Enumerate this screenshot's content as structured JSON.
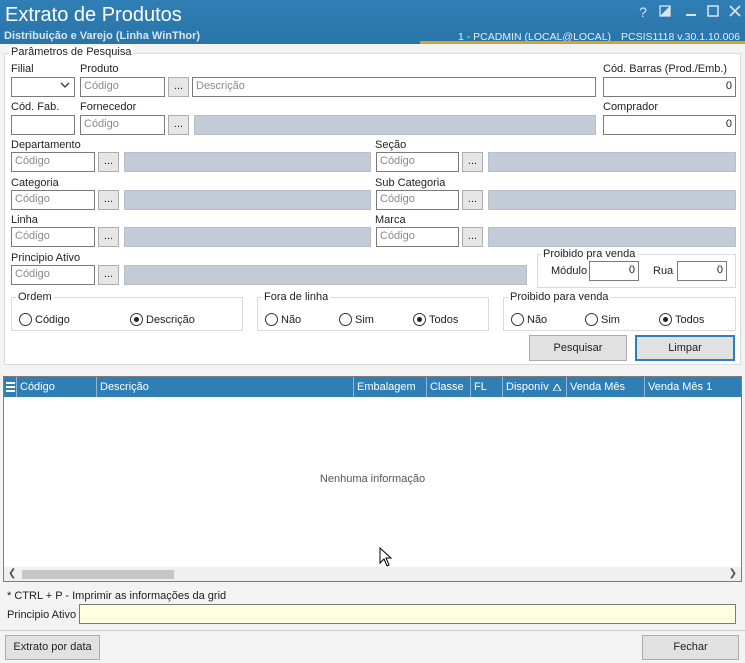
{
  "window": {
    "title": "Extrato de Produtos",
    "subtitle": "Distribuição e Varejo (Linha WinThor)",
    "help_glyph": "?",
    "userinfo": "1 - PCADMIN (LOCAL@LOCAL)",
    "version": "PCSIS1118  v.30.1.10.006"
  },
  "params": {
    "legend": "Parâmetros de Pesquisa",
    "filial": {
      "label": "Filial",
      "value": ""
    },
    "produto": {
      "label": "Produto",
      "code_placeholder": "Código",
      "desc_placeholder": "Descrição"
    },
    "cod_barras": {
      "label": "Cód. Barras (Prod./Emb.)",
      "value": "0"
    },
    "cod_fab": {
      "label": "Cód. Fab.",
      "value": ""
    },
    "fornecedor": {
      "label": "Fornecedor",
      "code_placeholder": "Código"
    },
    "comprador": {
      "label": "Comprador",
      "value": "0"
    },
    "departamento": {
      "label": "Departamento",
      "code_placeholder": "Código"
    },
    "secao": {
      "label": "Seção",
      "code_placeholder": "Código"
    },
    "categoria": {
      "label": "Categoria",
      "code_placeholder": "Código"
    },
    "sub_categoria": {
      "label": "Sub Categoria",
      "code_placeholder": "Código"
    },
    "linha": {
      "label": "Linha",
      "code_placeholder": "Código"
    },
    "marca": {
      "label": "Marca",
      "code_placeholder": "Código"
    },
    "principio_ativo": {
      "label": "Principio Ativo",
      "code_placeholder": "Código"
    },
    "proibido_venda_box": {
      "legend": "Proibido pra venda",
      "modulo_label": "Módulo",
      "modulo_value": "0",
      "rua_label": "Rua",
      "rua_value": "0"
    },
    "dots_label": "..."
  },
  "ordem": {
    "legend": "Ordem",
    "options": [
      {
        "label": "Código",
        "selected": false
      },
      {
        "label": "Descrição",
        "selected": true
      }
    ]
  },
  "fora_de_linha": {
    "legend": "Fora de linha",
    "options": [
      {
        "label": "Não",
        "selected": false
      },
      {
        "label": "Sim",
        "selected": false
      },
      {
        "label": "Todos",
        "selected": true
      }
    ]
  },
  "proibido_para_venda": {
    "legend": "Proibido para venda",
    "options": [
      {
        "label": "Não",
        "selected": false
      },
      {
        "label": "Sim",
        "selected": false
      },
      {
        "label": "Todos",
        "selected": true
      }
    ]
  },
  "actions": {
    "pesquisar": "Pesquisar",
    "limpar": "Limpar"
  },
  "grid": {
    "columns": [
      "Código",
      "Descrição",
      "Embalagem",
      "Classe",
      "FL",
      "Disponív",
      "Venda Mês",
      "Venda Mês 1"
    ],
    "empty_message": "Nenhuma informação"
  },
  "footer": {
    "hint": "* CTRL + P - Imprimir as informações da grid",
    "principio_label": "Principio Ativo",
    "extrato_button": "Extrato por data",
    "fechar_button": "Fechar"
  }
}
